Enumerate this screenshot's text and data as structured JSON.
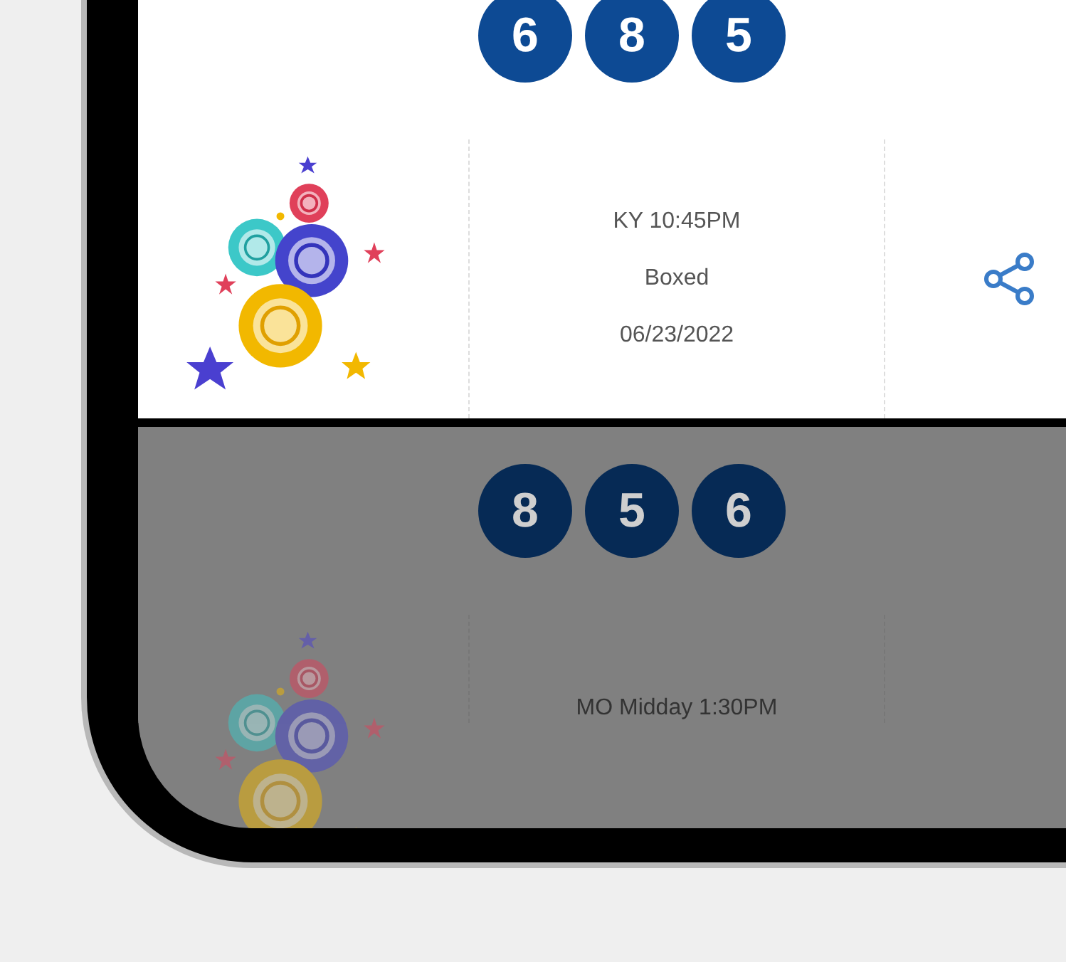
{
  "draws": [
    {
      "dimmed": false,
      "balls": [
        "6",
        "8",
        "5"
      ],
      "lines": [
        "KY 10:45PM",
        "Boxed",
        "06/23/2022"
      ]
    },
    {
      "dimmed": true,
      "balls": [
        "8",
        "5",
        "6"
      ],
      "lines": [
        "MO Midday 1:30PM"
      ]
    }
  ]
}
